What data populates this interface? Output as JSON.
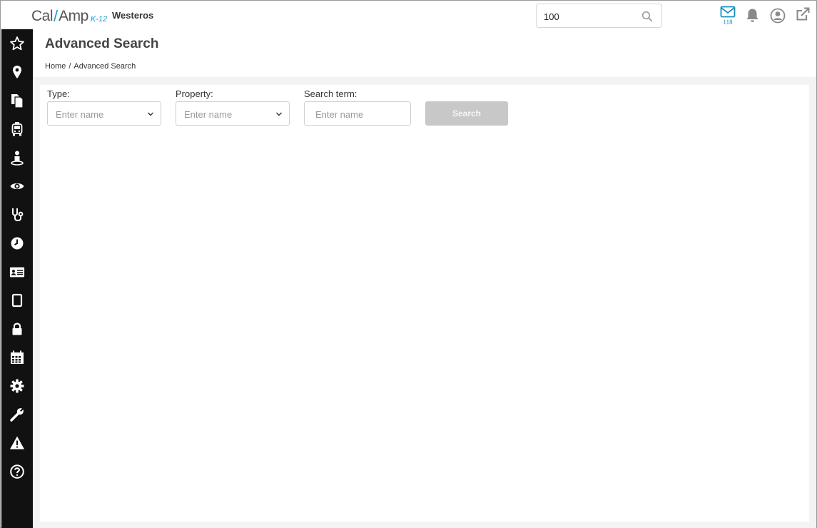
{
  "brand": {
    "logo_left": "Cal",
    "logo_right": "Amp",
    "logo_sub": "K-12",
    "org_name": "Westeros"
  },
  "header": {
    "search_value": "100",
    "mail_count": "118",
    "icons": [
      "search-icon",
      "mail-icon",
      "bell-icon",
      "user-circle-icon",
      "external-link-icon"
    ]
  },
  "sidebar": {
    "items": [
      {
        "icon": "star-icon"
      },
      {
        "icon": "map-pin-icon"
      },
      {
        "icon": "documents-icon"
      },
      {
        "icon": "bus-icon"
      },
      {
        "icon": "driver-icon"
      },
      {
        "icon": "eye-icon"
      },
      {
        "icon": "stethoscope-icon"
      },
      {
        "icon": "clock-icon"
      },
      {
        "icon": "id-card-icon"
      },
      {
        "icon": "tablet-icon"
      },
      {
        "icon": "lock-icon"
      },
      {
        "icon": "calendar-icon"
      },
      {
        "icon": "gear-icon"
      },
      {
        "icon": "wrench-icon"
      },
      {
        "icon": "warning-icon"
      },
      {
        "icon": "help-icon"
      }
    ]
  },
  "page": {
    "title": "Advanced Search",
    "breadcrumb": {
      "home": "Home",
      "separator": "/",
      "current": "Advanced Search"
    }
  },
  "form": {
    "type_label": "Type:",
    "type_placeholder": "Enter name",
    "property_label": "Property:",
    "property_placeholder": "Enter name",
    "term_label": "Search term:",
    "term_placeholder": "Enter name",
    "search_button": "Search"
  },
  "colors": {
    "sidebar_bg": "#111111",
    "accent": "#1a9ad6",
    "button_disabled": "#c8c8c8"
  }
}
